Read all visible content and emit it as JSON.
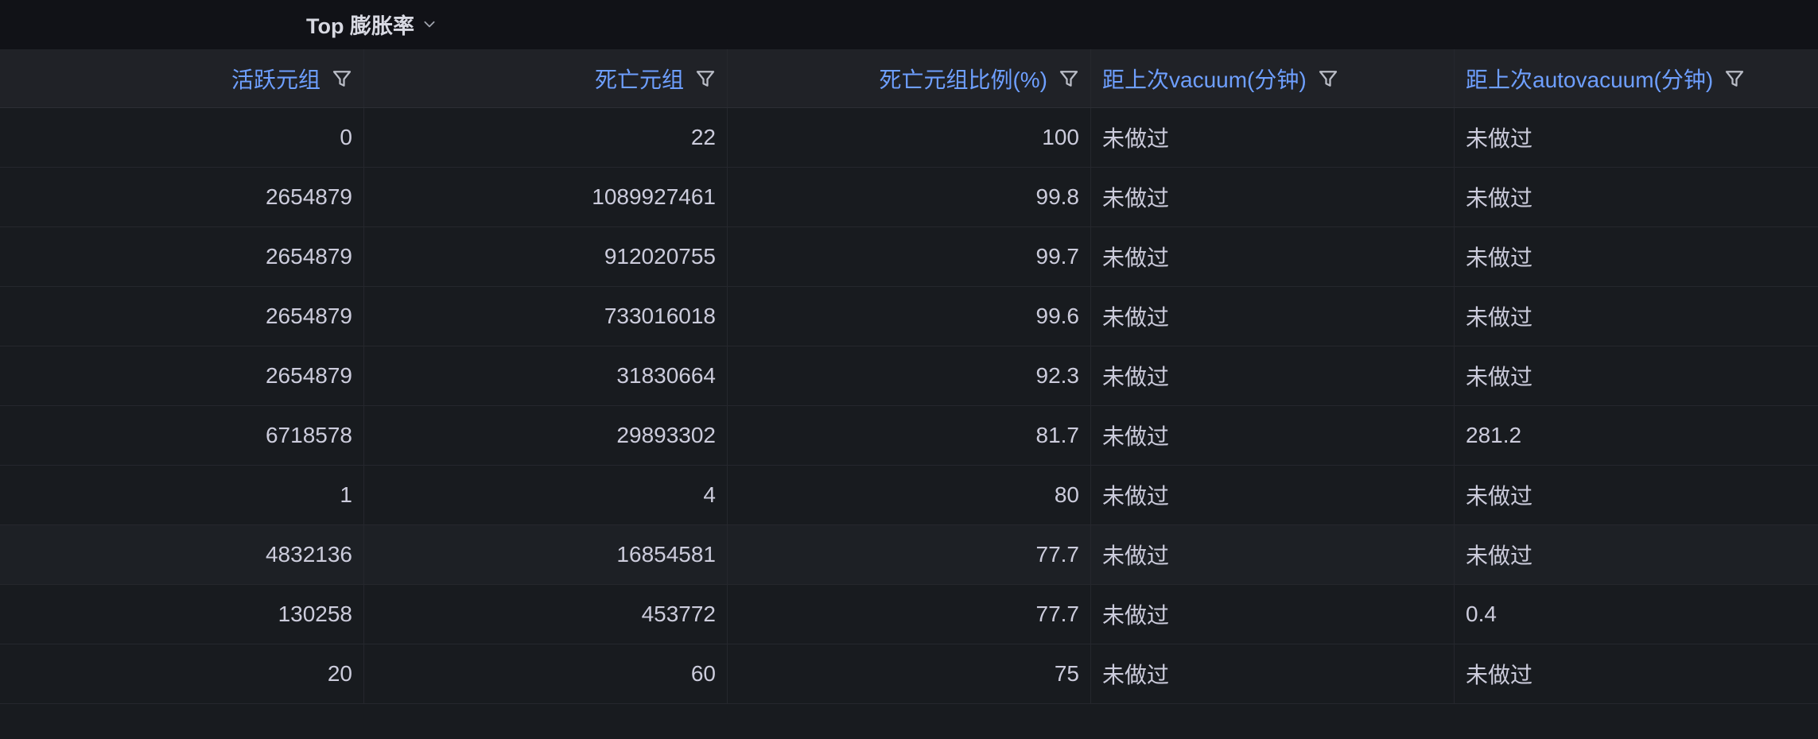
{
  "panel": {
    "title": "Top 膨胀率"
  },
  "columns": [
    {
      "label": "活跃元组",
      "align": "right"
    },
    {
      "label": "死亡元组",
      "align": "right"
    },
    {
      "label": "死亡元组比例(%)",
      "align": "right"
    },
    {
      "label": "距上次vacuum(分钟)",
      "align": "left"
    },
    {
      "label": "距上次autovacuum(分钟)",
      "align": "left"
    }
  ],
  "rows": [
    [
      "0",
      "22",
      "100",
      "未做过",
      "未做过"
    ],
    [
      "2654879",
      "1089927461",
      "99.8",
      "未做过",
      "未做过"
    ],
    [
      "2654879",
      "912020755",
      "99.7",
      "未做过",
      "未做过"
    ],
    [
      "2654879",
      "733016018",
      "99.6",
      "未做过",
      "未做过"
    ],
    [
      "2654879",
      "31830664",
      "92.3",
      "未做过",
      "未做过"
    ],
    [
      "6718578",
      "29893302",
      "81.7",
      "未做过",
      "281.2"
    ],
    [
      "1",
      "4",
      "80",
      "未做过",
      "未做过"
    ],
    [
      "4832136",
      "16854581",
      "77.7",
      "未做过",
      "未做过"
    ],
    [
      "130258",
      "453772",
      "77.7",
      "未做过",
      "0.4"
    ],
    [
      "20",
      "60",
      "75",
      "未做过",
      "未做过"
    ]
  ],
  "colors": {
    "header_text": "#6e9fff",
    "cell_text": "#ccccdc",
    "background": "#181b1f"
  }
}
